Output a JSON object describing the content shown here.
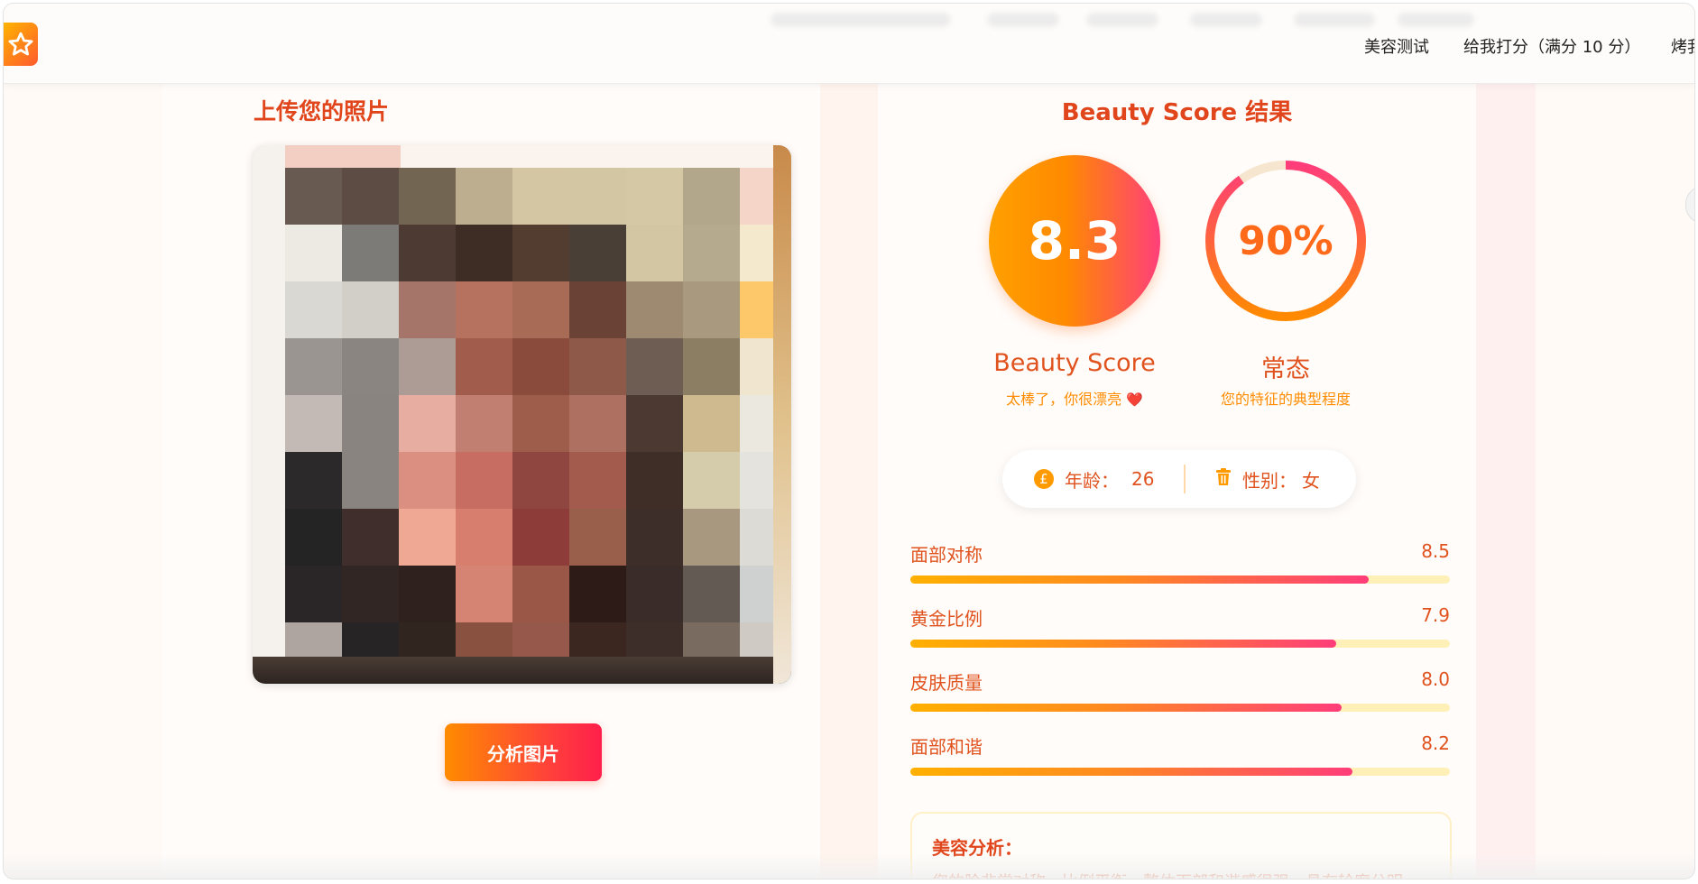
{
  "header": {
    "nav": [
      "美容测试",
      "给我打分（满分 10 分）",
      "烤我"
    ]
  },
  "upload": {
    "title": "上传您的照片",
    "analyze_button": "分析图片"
  },
  "photo": {
    "colors": [
      "#695a51",
      "#5d4c43",
      "#726552",
      "#bdae90",
      "#d4c6a3",
      "#d3c6a2",
      "#d5c8a4",
      "#b3a78b",
      "#f5d5c8",
      "#eceae2",
      "#7d7b78",
      "#4d3b33",
      "#3e2d24",
      "#523d30",
      "#4a3f36",
      "#d3c6a2",
      "#b6aa8e",
      "#f4e9cc",
      "#d9d8d2",
      "#d1cfc8",
      "#a47568",
      "#b6725f",
      "#a86b55",
      "#6a4336",
      "#9d8a70",
      "#a9997e",
      "#fcc86a",
      "#9b9592",
      "#8b8581",
      "#ad9c96",
      "#a15c4c",
      "#8a4a3c",
      "#8f5949",
      "#6e5d52",
      "#8b7e62",
      "#f0e6d0",
      "#c3bab6",
      "#8a8480",
      "#e6ada0",
      "#c07f70",
      "#9e5c4a",
      "#ad7061",
      "#4c3932",
      "#cfb98f",
      "#ebe8e0",
      "#2b2929",
      "#8a8480",
      "#da8f80",
      "#c76d62",
      "#8f4540",
      "#a25b4c",
      "#3f2d27",
      "#d4ccaa",
      "#e5e3de",
      "#252425",
      "#3f2e2c",
      "#eea893",
      "#d77e6e",
      "#8d3c3a",
      "#9a5f4a",
      "#3d2e2a",
      "#a99880",
      "#dcdbd6",
      "#2a2526",
      "#322624",
      "#2e211e",
      "#d58474",
      "#9a5748",
      "#2d1b18",
      "#3a2c28",
      "#635a54",
      "#cfd0d0",
      "#aea5a0",
      "#262425",
      "#312520",
      "#895140",
      "#96584a",
      "#3b2620",
      "#3e2e2a",
      "#7a6b60",
      "#cfcac3"
    ]
  },
  "results": {
    "title": "Beauty Score 结果",
    "beauty_score": "8.3",
    "beauty_label": "Beauty Score",
    "beauty_sub": "太棒了，你很漂亮",
    "heart_icon": "❤️",
    "typicality_percent": "90%",
    "typicality_value": 0.9,
    "typicality_label": "常态",
    "typicality_sub": "您的特征的典型程度",
    "age_label": "年龄：",
    "age_value": "26",
    "gender_label": "性别：",
    "gender_value": "女",
    "features": [
      {
        "name": "面部对称",
        "value": "8.5",
        "fraction": 0.85
      },
      {
        "name": "黄金比例",
        "value": "7.9",
        "fraction": 0.79
      },
      {
        "name": "皮肤质量",
        "value": "8.0",
        "fraction": 0.8
      },
      {
        "name": "面部和谐",
        "value": "8.2",
        "fraction": 0.82
      }
    ],
    "analysis_title": "美容分析：",
    "analysis_text": "您的脸非常对称，比例平衡，整体面部和谐感很强，具有轮廓分明"
  },
  "colors": {
    "accent": "#e0451b",
    "orange": "#ff8c00",
    "pink": "#ff3d7a"
  }
}
